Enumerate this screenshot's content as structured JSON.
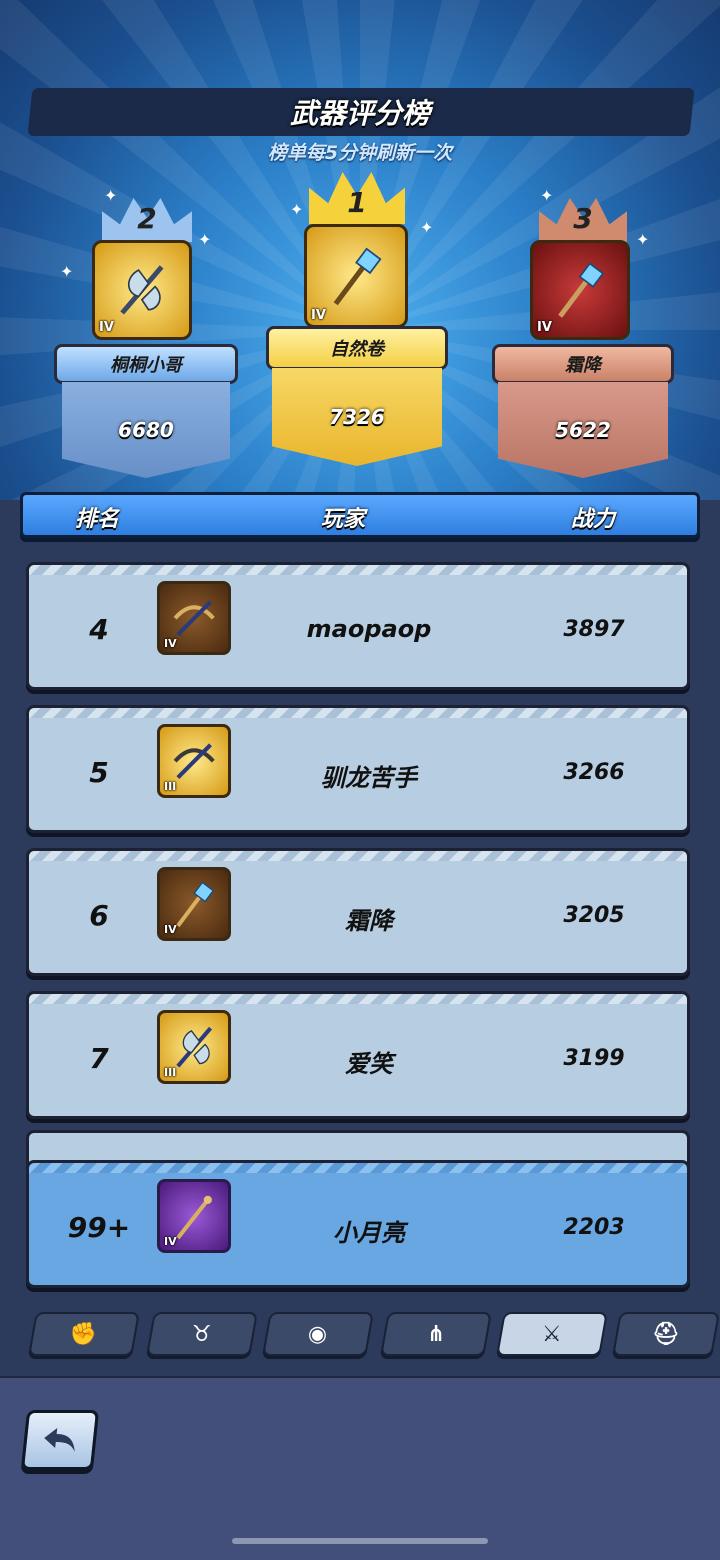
{
  "title": "武器评分榜",
  "subtitle": "榜单每5分钟刷新一次",
  "podium": [
    {
      "rank": "2",
      "player": "桐桐小哥",
      "power": "6680",
      "tier": "IV",
      "weapon_icon": "battle-axe-icon"
    },
    {
      "rank": "1",
      "player": "自然卷",
      "power": "7326",
      "tier": "IV",
      "weapon_icon": "crystal-staff-icon"
    },
    {
      "rank": "3",
      "player": "霜降",
      "power": "5622",
      "tier": "IV",
      "weapon_icon": "crystal-staff-icon"
    }
  ],
  "table_header": {
    "rank": "排名",
    "player": "玩家",
    "power": "战力"
  },
  "rows": [
    {
      "rank": "4",
      "player": "maopaop",
      "power": "3897",
      "tier": "IV",
      "weapon_icon": "crossbow-icon"
    },
    {
      "rank": "5",
      "player": "驯龙苦手",
      "power": "3266",
      "tier": "III",
      "weapon_icon": "crossbow-icon"
    },
    {
      "rank": "6",
      "player": "霜降",
      "power": "3205",
      "tier": "IV",
      "weapon_icon": "crystal-staff-icon"
    },
    {
      "rank": "7",
      "player": "爱笑",
      "power": "3199",
      "tier": "III",
      "weapon_icon": "battle-axe-icon"
    }
  ],
  "self_row": {
    "rank": "99+",
    "player": "小月亮",
    "power": "2203",
    "tier": "IV",
    "weapon_icon": "staff-icon"
  },
  "tabs": [
    {
      "icon": "fist-icon"
    },
    {
      "icon": "bull-icon"
    },
    {
      "icon": "target-icon"
    },
    {
      "icon": "branch-icon"
    },
    {
      "icon": "sword-icon",
      "active": true
    },
    {
      "icon": "helmet-icon"
    }
  ],
  "colors": {
    "gold": "#f2c53a",
    "silver": "#8fb6e6",
    "bronze": "#c7826b",
    "self_row": "#69a7e2"
  }
}
